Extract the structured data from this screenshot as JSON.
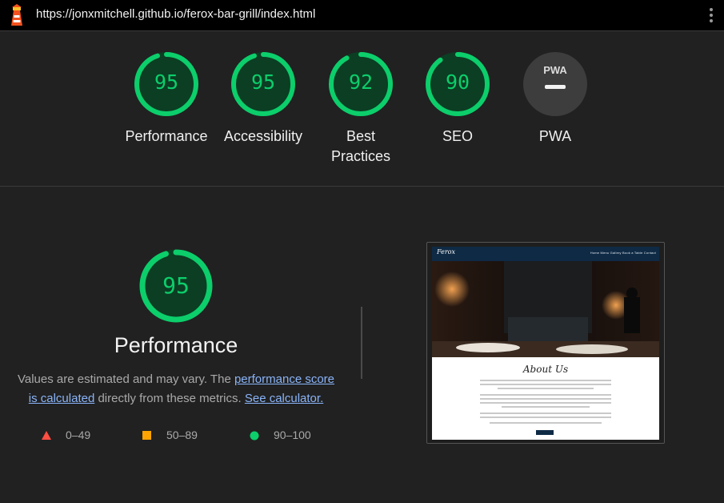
{
  "header": {
    "url": "https://jonxmitchell.github.io/ferox-bar-grill/index.html"
  },
  "gauges": [
    {
      "score": "95",
      "label": "Performance",
      "fraction": 0.95
    },
    {
      "score": "95",
      "label": "Accessibility",
      "fraction": 0.95
    },
    {
      "score": "92",
      "label": "Best\nPractices",
      "fraction": 0.92
    },
    {
      "score": "90",
      "label": "SEO",
      "fraction": 0.9
    },
    {
      "score": "",
      "label": "PWA",
      "badge": "PWA"
    }
  ],
  "performance": {
    "score": "95",
    "fraction": 0.95,
    "title": "Performance",
    "note_prefix": "Values are estimated and may vary. The ",
    "note_link1": "performance score is calculated",
    "note_middle": " directly from these metrics. ",
    "note_link2": "See calculator."
  },
  "legend": [
    {
      "range": "0–49",
      "shape": "triangle",
      "color": "#ff4e42"
    },
    {
      "range": "50–89",
      "shape": "square",
      "color": "#ffa400"
    },
    {
      "range": "90–100",
      "shape": "circle",
      "color": "#0cce6b"
    }
  ],
  "colors": {
    "pass": "#0cce6b",
    "pass_bg": "#0b3e23",
    "average": "#ffa400",
    "fail": "#ff4e42",
    "link": "#8ab4f8"
  },
  "screenshot": {
    "logo": "Ferox",
    "nav_links": "Home  Menu  Gallery  Book a Table  Contact",
    "section_title": "About Us"
  }
}
